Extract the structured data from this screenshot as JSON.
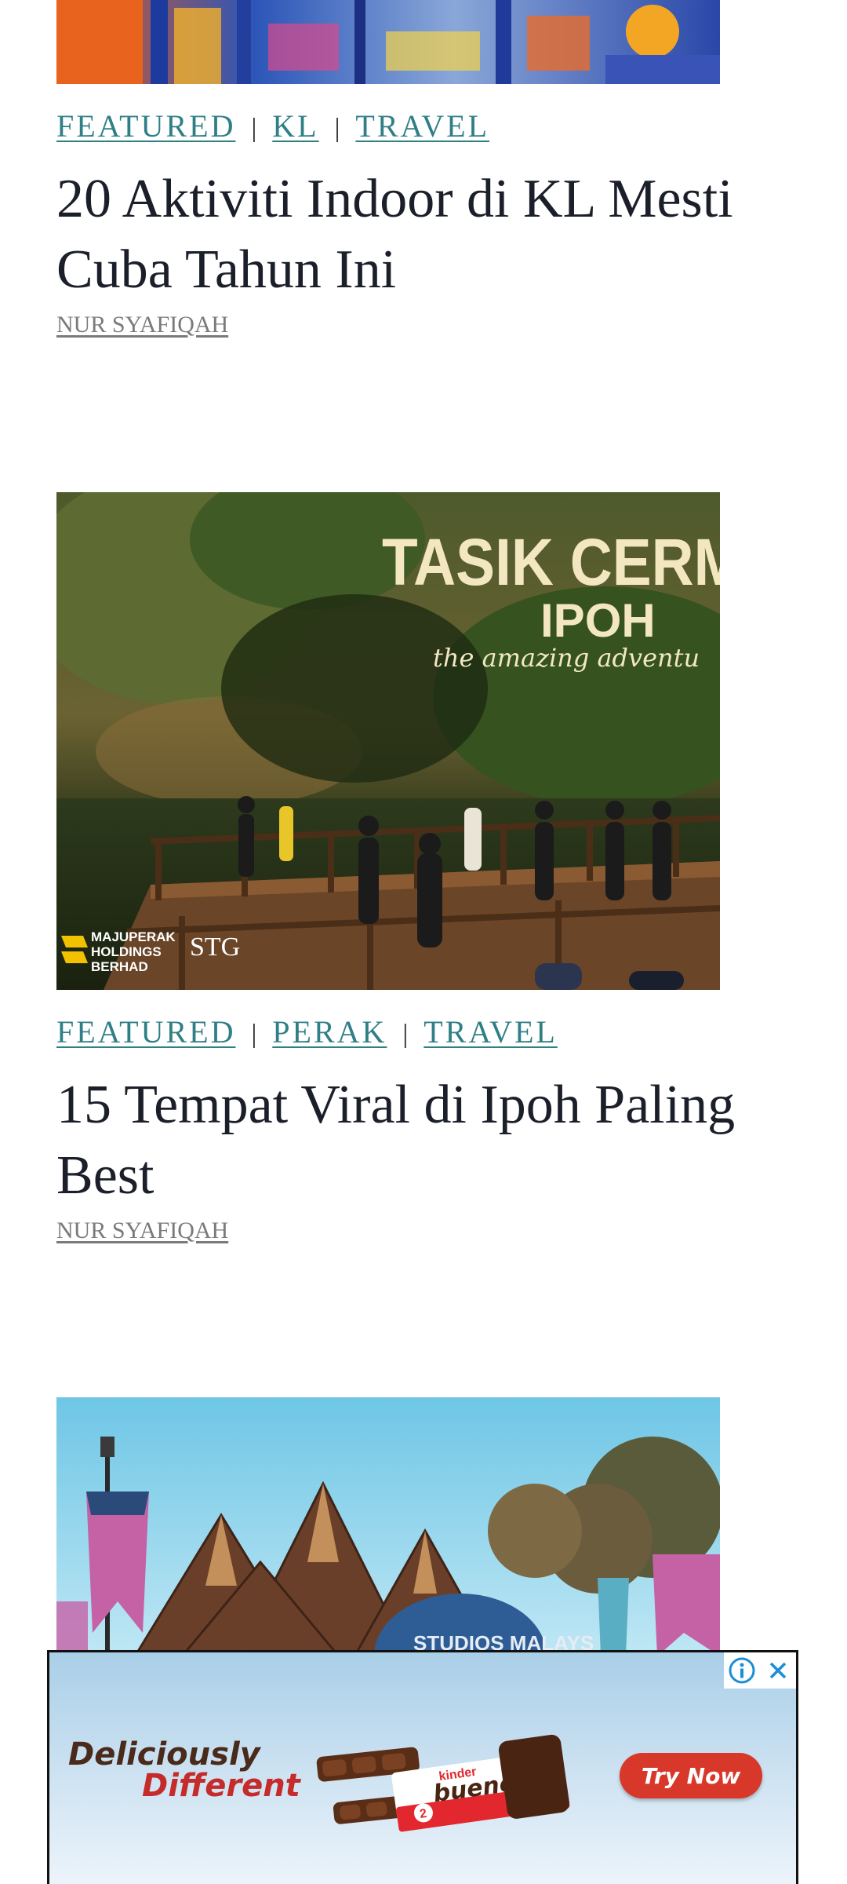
{
  "articles": [
    {
      "categories": [
        "FEATURED",
        "KL",
        "TRAVEL"
      ],
      "title": "20 Aktiviti Indoor di KL Mesti Cuba Tahun Ini",
      "author": "NUR SYAFIQAH"
    },
    {
      "image_text": {
        "headline": "TASIK CERM",
        "subhead": "IPOH",
        "tagline": "the amazing adventu",
        "logo_left": [
          "MAJUPERAK",
          "HOLDINGS",
          "BERHAD"
        ],
        "logo_right": "STG"
      },
      "categories": [
        "FEATURED",
        "PERAK",
        "TRAVEL"
      ],
      "title": "15 Tempat Viral di Ipoh Paling Best",
      "author": "NUR SYAFIQAH"
    },
    {
      "image_text": {
        "sign": "STUDIOS MALAYS"
      }
    }
  ],
  "ad": {
    "tagline_1": "Deliciously",
    "tagline_2": "Different",
    "product_brand": "kinder",
    "product_name": "bueno",
    "cta": "Try Now",
    "icons": [
      "info-icon",
      "close-icon"
    ]
  },
  "colors": {
    "category_link": "#2f7f86",
    "title": "#1b1f2a",
    "author": "#7a7a7a",
    "cta": "#d8382a"
  }
}
